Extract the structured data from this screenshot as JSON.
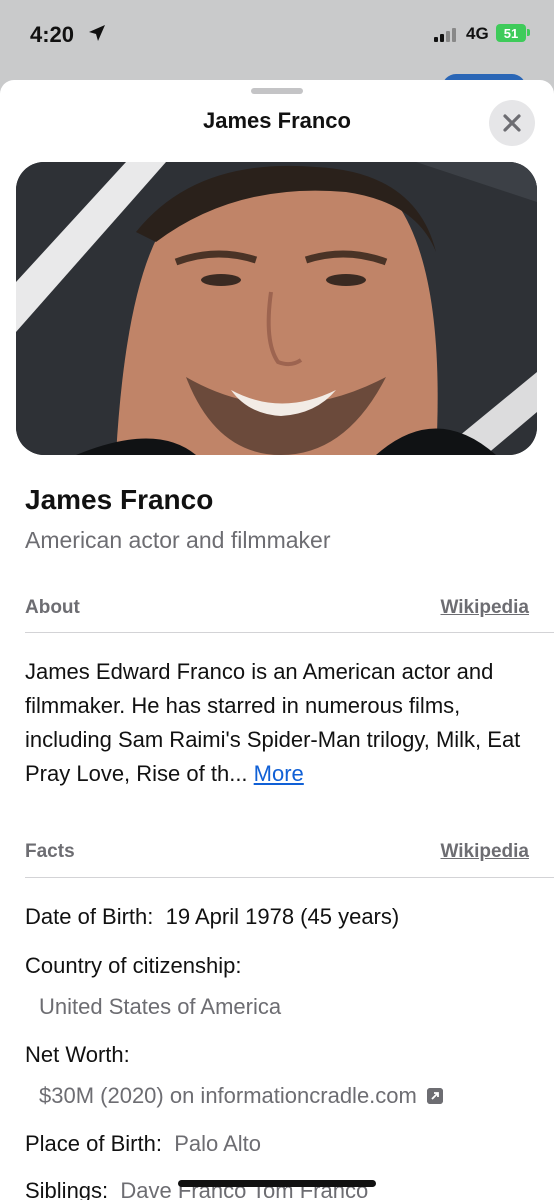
{
  "status": {
    "time": "4:20",
    "network": "4G",
    "battery": "51"
  },
  "sheet": {
    "title": "James Franco"
  },
  "entity": {
    "name": "James Franco",
    "description": "American actor and filmmaker"
  },
  "about": {
    "heading": "About",
    "source": "Wikipedia",
    "text": "James Edward Franco is an American actor and filmmaker. He has starred in numerous films, including Sam Raimi's Spider-Man trilogy, Milk, Eat Pray Love, Rise of th...",
    "more": "More"
  },
  "facts": {
    "heading": "Facts",
    "source": "Wikipedia",
    "dob_label": "Date of Birth:",
    "dob_value": "19 April 1978 (45 years)",
    "citizenship_label": "Country of citizenship:",
    "citizenship_value": "United States of America",
    "networth_label": "Net Worth:",
    "networth_value": "$30M (2020) on informationcradle.com",
    "pob_label": "Place of Birth:",
    "pob_value": "Palo Alto",
    "siblings_label": "Siblings:",
    "siblings_value": "Dave Franco   Tom Franco"
  },
  "icons": {
    "close": "close-icon",
    "location": "location-arrow-icon",
    "external": "external-link-icon"
  }
}
